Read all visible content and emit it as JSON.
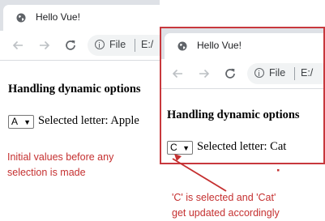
{
  "left_window": {
    "tab_title": "Hello Vue!",
    "address": {
      "scheme_label": "File",
      "path": "E:/"
    },
    "page": {
      "heading": "Handling dynamic options",
      "selected_option": "A",
      "selected_text": "Selected letter: Apple"
    }
  },
  "right_window": {
    "tab_title": "Hello Vue!",
    "address": {
      "scheme_label": "File",
      "path": "E:/"
    },
    "page": {
      "heading": "Handling dynamic options",
      "selected_option": "C",
      "selected_text": "Selected letter: Cat"
    }
  },
  "annotations": {
    "left_line1": "Initial values before any",
    "left_line2": "selection is made",
    "right_line1": "'C' is selected and 'Cat'",
    "right_line2": "get updated accordingly"
  },
  "colors": {
    "annotation": "#c53030",
    "highlight_border": "#c8383d",
    "tab_strip": "#dee1e6"
  },
  "icons": {
    "tab": "globe-icon",
    "back": "arrow-left-icon",
    "forward": "arrow-right-icon",
    "reload": "reload-icon",
    "info": "info-icon",
    "dropdown": "caret-down-icon"
  }
}
